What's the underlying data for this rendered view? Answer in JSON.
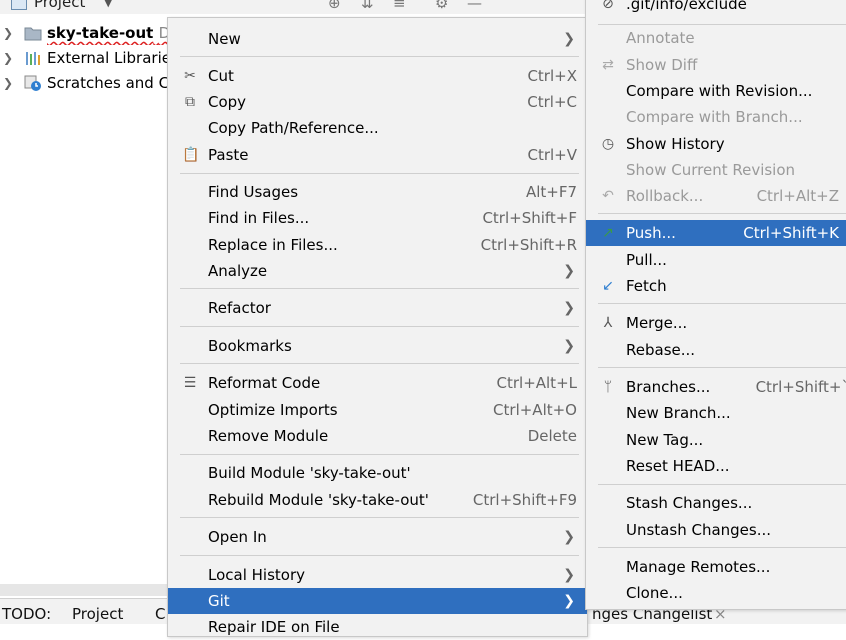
{
  "project_header": {
    "title": "Project"
  },
  "tree": {
    "root_name": "sky-take-out",
    "root_hint": "D:",
    "external": "External Libraries",
    "scratches": "Scratches and Consoles"
  },
  "bottom_bar": {
    "todo": "TODO:",
    "project": "Project",
    "c": "C",
    "changelist": "nges Changelist",
    "close": "×"
  },
  "main_menu": {
    "new": "New",
    "cut": "Cut",
    "cut_sc": "Ctrl+X",
    "copy": "Copy",
    "copy_sc": "Ctrl+C",
    "copy_path": "Copy Path/Reference...",
    "paste": "Paste",
    "paste_sc": "Ctrl+V",
    "find_usages": "Find Usages",
    "find_usages_sc": "Alt+F7",
    "find_in_files": "Find in Files...",
    "find_in_files_sc": "Ctrl+Shift+F",
    "replace_in_files": "Replace in Files...",
    "replace_in_files_sc": "Ctrl+Shift+R",
    "analyze": "Analyze",
    "refactor": "Refactor",
    "bookmarks": "Bookmarks",
    "reformat": "Reformat Code",
    "reformat_sc": "Ctrl+Alt+L",
    "optimize": "Optimize Imports",
    "optimize_sc": "Ctrl+Alt+O",
    "remove_module": "Remove Module",
    "remove_module_sc": "Delete",
    "build_module": "Build Module 'sky-take-out'",
    "rebuild_module": "Rebuild Module 'sky-take-out'",
    "rebuild_module_sc": "Ctrl+Shift+F9",
    "open_in": "Open In",
    "local_history": "Local History",
    "git": "Git",
    "repair": "Repair IDE on File"
  },
  "git_menu": {
    "exclude": ".git/info/exclude",
    "annotate": "Annotate",
    "show_diff": "Show Diff",
    "compare_revision": "Compare with Revision...",
    "compare_branch": "Compare with Branch...",
    "show_history": "Show History",
    "show_current_revision": "Show Current Revision",
    "rollback": "Rollback...",
    "rollback_sc": "Ctrl+Alt+Z",
    "push": "Push...",
    "push_sc": "Ctrl+Shift+K",
    "pull": "Pull...",
    "fetch": "Fetch",
    "merge": "Merge...",
    "rebase": "Rebase...",
    "branches": "Branches...",
    "branches_sc": "Ctrl+Shift+`",
    "new_branch": "New Branch...",
    "new_tag": "New Tag...",
    "reset_head": "Reset HEAD...",
    "stash": "Stash Changes...",
    "unstash": "Unstash Changes...",
    "manage_remotes": "Manage Remotes...",
    "clone": "Clone..."
  },
  "colors": {
    "selection": "#2f6fbf",
    "menu_bg": "#f2f2f2",
    "push_icon": "#3a9a4a",
    "fetch_icon": "#2f7fd0"
  }
}
